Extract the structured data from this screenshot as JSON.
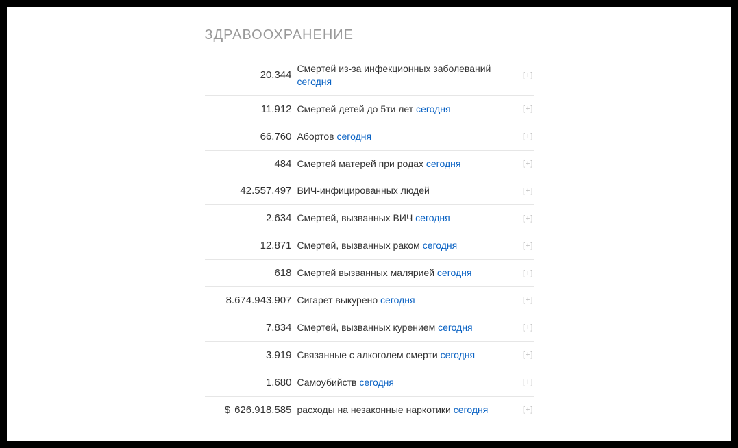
{
  "section_title": "ЗДРАВООХРАНЕНИЕ",
  "link_word": "сегодня",
  "expand_label": "[+]",
  "rows": [
    {
      "value": "20.344",
      "currency": "",
      "text_before": "Смертей из-за инфекционных заболеваний ",
      "has_link": true
    },
    {
      "value": "11.912",
      "currency": "",
      "text_before": "Смертей детей до 5ти лет ",
      "has_link": true
    },
    {
      "value": "66.760",
      "currency": "",
      "text_before": "Абортов ",
      "has_link": true
    },
    {
      "value": "484",
      "currency": "",
      "text_before": "Смертей матерей при родах ",
      "has_link": true
    },
    {
      "value": "42.557.497",
      "currency": "",
      "text_before": "ВИЧ-инфицированных людей",
      "has_link": false
    },
    {
      "value": "2.634",
      "currency": "",
      "text_before": "Смертей, вызванных ВИЧ ",
      "has_link": true
    },
    {
      "value": "12.871",
      "currency": "",
      "text_before": "Смертей, вызванных раком ",
      "has_link": true
    },
    {
      "value": "618",
      "currency": "",
      "text_before": "Смертей вызванных малярией ",
      "has_link": true
    },
    {
      "value": "8.674.943.907",
      "currency": "",
      "text_before": "Сигарет выкурено ",
      "has_link": true
    },
    {
      "value": "7.834",
      "currency": "",
      "text_before": "Смертей, вызванных курением ",
      "has_link": true
    },
    {
      "value": "3.919",
      "currency": "",
      "text_before": "Связанные с алкоголем смерти ",
      "has_link": true
    },
    {
      "value": "1.680",
      "currency": "",
      "text_before": "Самоубийств ",
      "has_link": true
    },
    {
      "value": "626.918.585",
      "currency": "$",
      "text_before": "расходы на незаконные наркотики ",
      "has_link": true
    }
  ]
}
